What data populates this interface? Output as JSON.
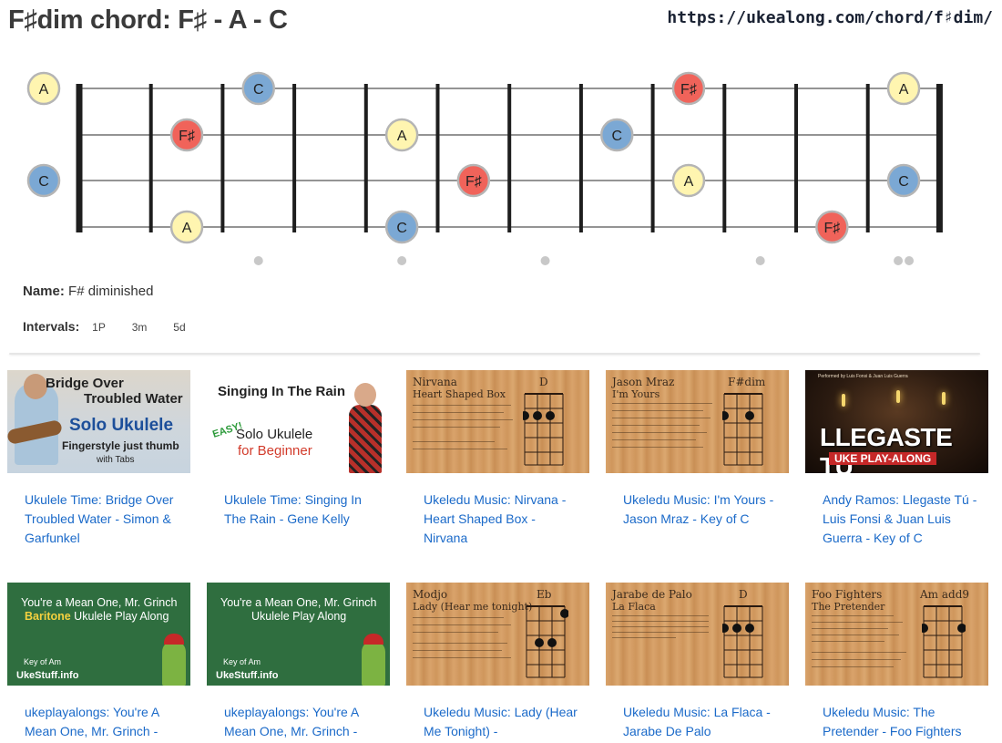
{
  "header": {
    "title": "F♯dim chord: F♯ - A - C",
    "url": "https://ukealong.com/chord/f♯dim/"
  },
  "fretboard": {
    "strings": 4,
    "frets": 12,
    "open_notes": [
      "A",
      "",
      "C",
      ""
    ],
    "notes": [
      {
        "string": 1,
        "fret": 0,
        "note": "A"
      },
      {
        "string": 1,
        "fret": 3,
        "note": "C"
      },
      {
        "string": 1,
        "fret": 9,
        "note": "F♯"
      },
      {
        "string": 1,
        "fret": 12,
        "note": "A"
      },
      {
        "string": 2,
        "fret": 2,
        "note": "F♯"
      },
      {
        "string": 2,
        "fret": 5,
        "note": "A"
      },
      {
        "string": 2,
        "fret": 8,
        "note": "C"
      },
      {
        "string": 3,
        "fret": 0,
        "note": "C"
      },
      {
        "string": 3,
        "fret": 6,
        "note": "F♯"
      },
      {
        "string": 3,
        "fret": 9,
        "note": "A"
      },
      {
        "string": 3,
        "fret": 12,
        "note": "C"
      },
      {
        "string": 4,
        "fret": 2,
        "note": "A"
      },
      {
        "string": 4,
        "fret": 5,
        "note": "C"
      },
      {
        "string": 4,
        "fret": 11,
        "note": "F♯"
      }
    ],
    "inlay_frets": [
      3,
      5,
      7,
      10
    ],
    "double_inlay_fret": 12,
    "note_colors": {
      "A": "#fff5b0",
      "C": "#7ba8d4",
      "F♯": "#f0635a"
    }
  },
  "info": {
    "name_label": "Name:",
    "name_value": "F# diminished",
    "intervals_label": "Intervals:",
    "intervals": [
      "1P",
      "3m",
      "5d"
    ]
  },
  "videos": [
    {
      "title": "Ukulele Time: Bridge Over Troubled Water - Simon & Garfunkel",
      "thumb": {
        "lines": [
          "Bridge Over",
          "Troubled Water"
        ],
        "sub": "Solo Ukulele",
        "sub2": "Fingerstyle just thumb",
        "sub3": "with Tabs"
      }
    },
    {
      "title": "Ukulele Time: Singing In The Rain - Gene Kelly",
      "thumb": {
        "line1": "Singing In The Rain",
        "easy": "EASY!",
        "line2": "Solo Ukulele",
        "line3": "for Beginner"
      }
    },
    {
      "title": "Ukeledu Music: Nirvana - Heart Shaped Box - Nirvana",
      "thumb": {
        "artist": "Nirvana",
        "song": "Heart Shaped Box",
        "chord": "D"
      }
    },
    {
      "title": "Ukeledu Music: I'm Yours - Jason Mraz - Key of C",
      "thumb": {
        "artist": "Jason Mraz",
        "song": "I'm Yours",
        "chord": "F#dim"
      }
    },
    {
      "title": "Andy Ramos: Llegaste Tú - Luis Fonsi & Juan Luis Guerra - Key of C",
      "thumb": {
        "top": "Performed by Luis Fonsi & Juan Luis Guerra",
        "big": "LLEGASTE TU",
        "band": "UKE PLAY-ALONG"
      }
    },
    {
      "title": "ukeplayalongs: You're A Mean One, Mr. Grinch -",
      "thumb": {
        "line1": "You're a Mean One, Mr. Grinch",
        "line2a": "Baritone",
        "line2b": " Ukulele Play Along",
        "key": "Key of Am",
        "brand": "UkeStuff.info"
      }
    },
    {
      "title": "ukeplayalongs: You're A Mean One, Mr. Grinch -",
      "thumb": {
        "line1": "You're a Mean One, Mr. Grinch",
        "line2": "Ukulele Play Along",
        "key": "Key of Am",
        "brand": "UkeStuff.info"
      }
    },
    {
      "title": "Ukeledu Music: Lady (Hear Me Tonight) -",
      "thumb": {
        "artist": "Modjo",
        "song": "Lady (Hear me tonight)",
        "chord": "Eb"
      }
    },
    {
      "title": "Ukeledu Music: La Flaca - Jarabe De Palo",
      "thumb": {
        "artist": "Jarabe de Palo",
        "song": "La Flaca",
        "chord": "D"
      }
    },
    {
      "title": "Ukeledu Music: The Pretender - Foo Fighters",
      "thumb": {
        "artist": "Foo Fighters",
        "song": "The Pretender",
        "chord": "Am add9"
      }
    }
  ]
}
